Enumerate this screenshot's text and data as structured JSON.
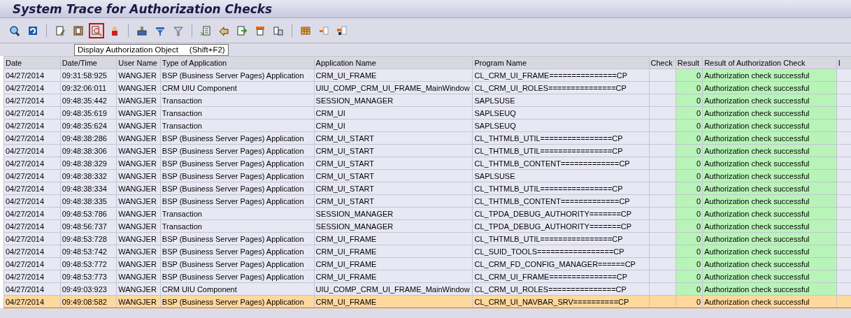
{
  "window": {
    "title": "System Trace for Authorization Checks"
  },
  "toolbar": [
    {
      "selected": false
    },
    {
      "selected": false
    },
    {
      "selected": false
    },
    {
      "selected": false
    },
    {
      "selected": true
    },
    {
      "selected": false
    },
    {
      "selected": false
    },
    {
      "selected": false
    },
    {
      "selected": false
    },
    {
      "selected": false
    },
    {
      "selected": false
    },
    {
      "selected": false
    },
    {
      "selected": false
    },
    {
      "selected": false
    },
    {
      "selected": false
    },
    {
      "selected": false
    },
    {
      "selected": false
    }
  ],
  "tooltip": {
    "text": "Display Authorization Object",
    "shortcut": "(Shift+F2)"
  },
  "table": {
    "columns": [
      "Date",
      "Date/Time",
      "User Name",
      "Type of Application",
      "Application Name",
      "Program Name",
      "Check",
      "Result",
      "Result of Authorization Check",
      "I"
    ],
    "rows": [
      {
        "cells": [
          "04/27/2014",
          "09:31:58:925",
          "WANGJER",
          "BSP (Business Server Pages) Application",
          "CRM_UI_FRAME",
          "CL_CRM_UI_FRAME===============CP",
          "",
          "0",
          "Authorization check successful"
        ],
        "selected": false
      },
      {
        "cells": [
          "04/27/2014",
          "09:32:06:011",
          "WANGJER",
          "CRM UIU Component",
          "UIU_COMP_CRM_UI_FRAME_MainWindow",
          "CL_CRM_UI_ROLES===============CP",
          "",
          "0",
          "Authorization check successful"
        ],
        "selected": false
      },
      {
        "cells": [
          "04/27/2014",
          "09:48:35:442",
          "WANGJER",
          "Transaction",
          "SESSION_MANAGER",
          "SAPLSUSE",
          "",
          "0",
          "Authorization check successful"
        ],
        "selected": false
      },
      {
        "cells": [
          "04/27/2014",
          "09:48:35:619",
          "WANGJER",
          "Transaction",
          "CRM_UI",
          "SAPLSEUQ",
          "",
          "0",
          "Authorization check successful"
        ],
        "selected": false
      },
      {
        "cells": [
          "04/27/2014",
          "09:48:35:624",
          "WANGJER",
          "Transaction",
          "CRM_UI",
          "SAPLSEUQ",
          "",
          "0",
          "Authorization check successful"
        ],
        "selected": false
      },
      {
        "cells": [
          "04/27/2014",
          "09:48:38:286",
          "WANGJER",
          "BSP (Business Server Pages) Application",
          "CRM_UI_START",
          "CL_THTMLB_UTIL================CP",
          "",
          "0",
          "Authorization check successful"
        ],
        "selected": false
      },
      {
        "cells": [
          "04/27/2014",
          "09:48:38:306",
          "WANGJER",
          "BSP (Business Server Pages) Application",
          "CRM_UI_START",
          "CL_THTMLB_UTIL================CP",
          "",
          "0",
          "Authorization check successful"
        ],
        "selected": false
      },
      {
        "cells": [
          "04/27/2014",
          "09:48:38:329",
          "WANGJER",
          "BSP (Business Server Pages) Application",
          "CRM_UI_START",
          "CL_THTMLB_CONTENT=============CP",
          "",
          "0",
          "Authorization check successful"
        ],
        "selected": false
      },
      {
        "cells": [
          "04/27/2014",
          "09:48:38:332",
          "WANGJER",
          "BSP (Business Server Pages) Application",
          "CRM_UI_START",
          "SAPLSUSE",
          "",
          "0",
          "Authorization check successful"
        ],
        "selected": false
      },
      {
        "cells": [
          "04/27/2014",
          "09:48:38:334",
          "WANGJER",
          "BSP (Business Server Pages) Application",
          "CRM_UI_START",
          "CL_THTMLB_UTIL================CP",
          "",
          "0",
          "Authorization check successful"
        ],
        "selected": false
      },
      {
        "cells": [
          "04/27/2014",
          "09:48:38:335",
          "WANGJER",
          "BSP (Business Server Pages) Application",
          "CRM_UI_START",
          "CL_THTMLB_CONTENT=============CP",
          "",
          "0",
          "Authorization check successful"
        ],
        "selected": false
      },
      {
        "cells": [
          "04/27/2014",
          "09:48:53:786",
          "WANGJER",
          "Transaction",
          "SESSION_MANAGER",
          "CL_TPDA_DEBUG_AUTHORITY=======CP",
          "",
          "0",
          "Authorization check successful"
        ],
        "selected": false
      },
      {
        "cells": [
          "04/27/2014",
          "09:48:56:737",
          "WANGJER",
          "Transaction",
          "SESSION_MANAGER",
          "CL_TPDA_DEBUG_AUTHORITY=======CP",
          "",
          "0",
          "Authorization check successful"
        ],
        "selected": false
      },
      {
        "cells": [
          "04/27/2014",
          "09:48:53:728",
          "WANGJER",
          "BSP (Business Server Pages) Application",
          "CRM_UI_FRAME",
          "CL_THTMLB_UTIL================CP",
          "",
          "0",
          "Authorization check successful"
        ],
        "selected": false
      },
      {
        "cells": [
          "04/27/2014",
          "09:48:53:742",
          "WANGJER",
          "BSP (Business Server Pages) Application",
          "CRM_UI_FRAME",
          "CL_SUID_TOOLS=================CP",
          "",
          "0",
          "Authorization check successful"
        ],
        "selected": false
      },
      {
        "cells": [
          "04/27/2014",
          "09:48:53:772",
          "WANGJER",
          "BSP (Business Server Pages) Application",
          "CRM_UI_FRAME",
          "CL_CRM_FD_CONFIG_MANAGER======CP",
          "",
          "0",
          "Authorization check successful"
        ],
        "selected": false
      },
      {
        "cells": [
          "04/27/2014",
          "09:48:53:773",
          "WANGJER",
          "BSP (Business Server Pages) Application",
          "CRM_UI_FRAME",
          "CL_CRM_UI_FRAME===============CP",
          "",
          "0",
          "Authorization check successful"
        ],
        "selected": false
      },
      {
        "cells": [
          "04/27/2014",
          "09:49:03:923",
          "WANGJER",
          "CRM UIU Component",
          "UIU_COMP_CRM_UI_FRAME_MainWindow",
          "CL_CRM_UI_ROLES===============CP",
          "",
          "0",
          "Authorization check successful"
        ],
        "selected": false
      },
      {
        "cells": [
          "04/27/2014",
          "09:49:08:582",
          "WANGJER",
          "BSP (Business Server Pages) Application",
          "CRM_UI_FRAME",
          "CL_CRM_UI_NAVBAR_SRV==========CP",
          "",
          "0",
          "Authorization check successful"
        ],
        "selected": true
      }
    ]
  }
}
